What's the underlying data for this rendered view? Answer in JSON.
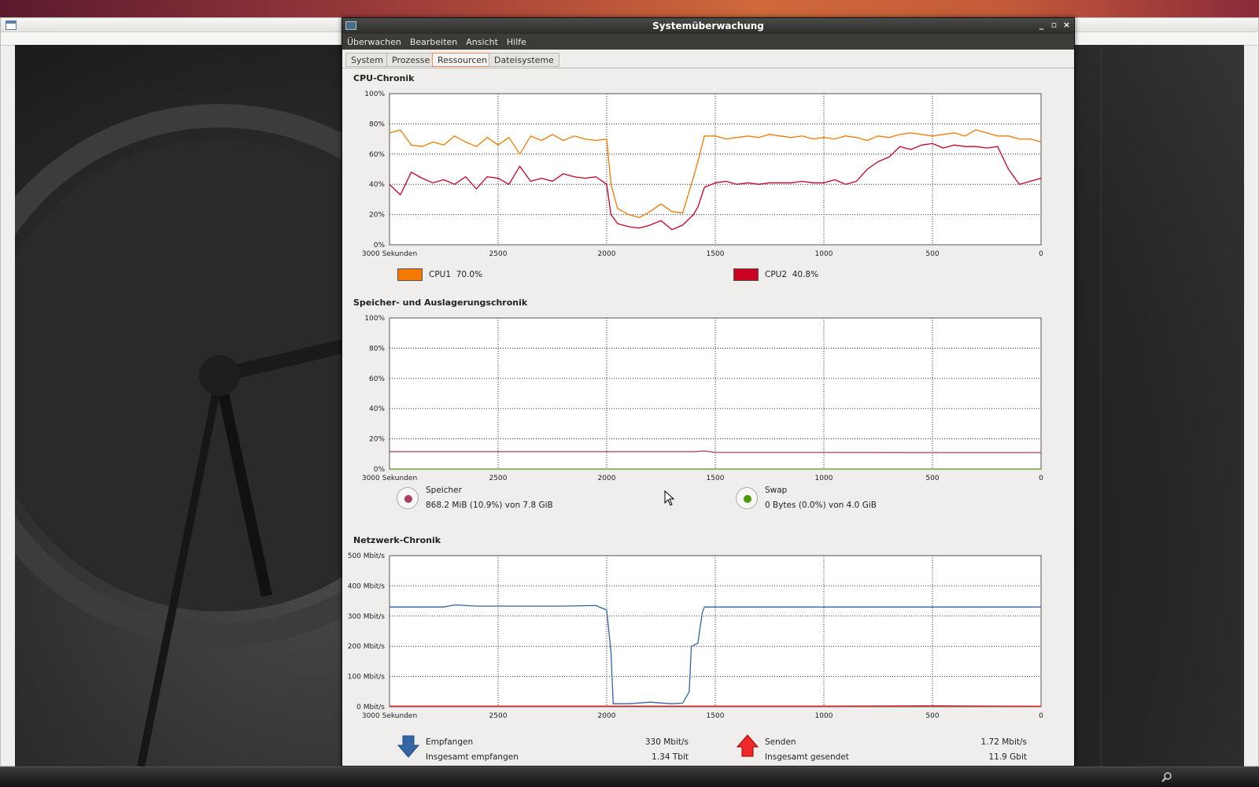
{
  "window": {
    "title": "Systemüberwachung",
    "controls": [
      "_",
      "▫",
      "×"
    ]
  },
  "menu": [
    "Überwachen",
    "Bearbeiten",
    "Ansicht",
    "Hilfe"
  ],
  "tabs": [
    {
      "label": "System",
      "active": false
    },
    {
      "label": "Prozesse",
      "active": false
    },
    {
      "label": "Ressourcen",
      "active": true
    },
    {
      "label": "Dateisysteme",
      "active": false
    }
  ],
  "x_ticks": [
    "3000 Sekunden",
    "2500",
    "2000",
    "1500",
    "1000",
    "500",
    "0"
  ],
  "cpu": {
    "title": "CPU-Chronik",
    "y_ticks": [
      "100%",
      "80%",
      "60%",
      "40%",
      "20%",
      "0%"
    ],
    "legend": [
      {
        "name": "CPU1",
        "value": "70.0%",
        "color": "#f57900"
      },
      {
        "name": "CPU2",
        "value": "40.8%",
        "color": "#cc0022"
      }
    ]
  },
  "memory": {
    "title": "Speicher- und Auslagerungschronik",
    "y_ticks": [
      "100%",
      "80%",
      "60%",
      "40%",
      "20%",
      "0%"
    ],
    "speicher_label": "Speicher",
    "speicher_value": "868.2 MiB (10.9%) von 7.8 GiB",
    "speicher_color": "#ad3d65",
    "swap_label": "Swap",
    "swap_value": "0 Bytes (0.0%) von 4.0 GiB",
    "swap_color": "#4e9a06"
  },
  "network": {
    "title": "Netzwerk-Chronik",
    "y_ticks": [
      "500 Mbit/s",
      "400 Mbit/s",
      "300 Mbit/s",
      "200 Mbit/s",
      "100 Mbit/s",
      "0 Mbit/s"
    ],
    "recv_label": "Empfangen",
    "recv_value": "330 Mbit/s",
    "recv_total_label": "Insgesamt empfangen",
    "recv_total_value": "1.34 Tbit",
    "recv_color": "#3465a4",
    "send_label": "Senden",
    "send_value": "1.72 Mbit/s",
    "send_total_label": "Insgesamt gesendet",
    "send_total_value": "11.9 Gbit",
    "send_color": "#ef2929"
  },
  "chart_data": [
    {
      "type": "line",
      "x": [
        3000,
        2950,
        2900,
        2850,
        2800,
        2750,
        2700,
        2650,
        2600,
        2550,
        2500,
        2450,
        2400,
        2350,
        2300,
        2250,
        2200,
        2150,
        2100,
        2050,
        2000,
        1980,
        1950,
        1900,
        1850,
        1800,
        1750,
        1700,
        1650,
        1600,
        1580,
        1550,
        1500,
        1450,
        1400,
        1350,
        1300,
        1250,
        1200,
        1150,
        1100,
        1050,
        1000,
        950,
        900,
        850,
        800,
        750,
        700,
        650,
        600,
        550,
        500,
        450,
        400,
        350,
        300,
        250,
        200,
        150,
        100,
        50,
        0
      ],
      "series": [
        {
          "name": "CPU1",
          "values": [
            74,
            76,
            66,
            65,
            68,
            66,
            72,
            68,
            65,
            71,
            66,
            71,
            60,
            72,
            69,
            73,
            69,
            72,
            70,
            69,
            70,
            40,
            24,
            20,
            18,
            22,
            27,
            22,
            21,
            45,
            55,
            72,
            72,
            70,
            71,
            72,
            71,
            73,
            72,
            71,
            72,
            70,
            71,
            70,
            72,
            71,
            69,
            72,
            71,
            73,
            74,
            73,
            72,
            73,
            74,
            72,
            76,
            74,
            72,
            72,
            70,
            70,
            68
          ]
        },
        {
          "name": "CPU2",
          "values": [
            40,
            33,
            48,
            44,
            41,
            43,
            40,
            45,
            37,
            45,
            44,
            40,
            52,
            42,
            44,
            42,
            47,
            45,
            44,
            45,
            40,
            20,
            14,
            12,
            11,
            13,
            16,
            10,
            13,
            20,
            25,
            38,
            41,
            42,
            40,
            41,
            40,
            41,
            41,
            41,
            42,
            41,
            41,
            43,
            40,
            42,
            50,
            55,
            58,
            65,
            63,
            66,
            67,
            64,
            66,
            65,
            65,
            64,
            65,
            50,
            40,
            42,
            44
          ]
        }
      ],
      "title": "CPU-Chronik",
      "xlabel": "Sekunden",
      "ylim": [
        0,
        100
      ],
      "grid": true
    },
    {
      "type": "line",
      "x": [
        3000,
        2000,
        1600,
        1550,
        1500,
        1000,
        500,
        0
      ],
      "series": [
        {
          "name": "Speicher",
          "values": [
            11.5,
            11.5,
            11.5,
            12,
            11,
            11,
            10.9,
            10.9
          ]
        },
        {
          "name": "Swap",
          "values": [
            0,
            0,
            0,
            0,
            0,
            0,
            0,
            0
          ]
        }
      ],
      "title": "Speicher- und Auslagerungschronik",
      "xlabel": "Sekunden",
      "ylim": [
        0,
        100
      ],
      "grid": true
    },
    {
      "type": "line",
      "x": [
        3000,
        2750,
        2700,
        2600,
        2400,
        2200,
        2050,
        2000,
        1980,
        1970,
        1950,
        1900,
        1800,
        1700,
        1650,
        1620,
        1610,
        1580,
        1560,
        1550,
        1500,
        1000,
        500,
        0
      ],
      "series": [
        {
          "name": "Empfangen",
          "values": [
            330,
            330,
            337,
            333,
            333,
            333,
            335,
            320,
            180,
            10,
            10,
            10,
            15,
            10,
            12,
            50,
            200,
            210,
            310,
            330,
            330,
            330,
            330,
            330
          ]
        },
        {
          "name": "Senden",
          "values": [
            2,
            2,
            2,
            2,
            2,
            2,
            2,
            2,
            2,
            2,
            2,
            2,
            2,
            2,
            2,
            2,
            2,
            2,
            2,
            2,
            2,
            2,
            3,
            1.72
          ]
        }
      ],
      "title": "Netzwerk-Chronik",
      "xlabel": "Sekunden",
      "ylim": [
        0,
        500
      ],
      "grid": true
    }
  ]
}
